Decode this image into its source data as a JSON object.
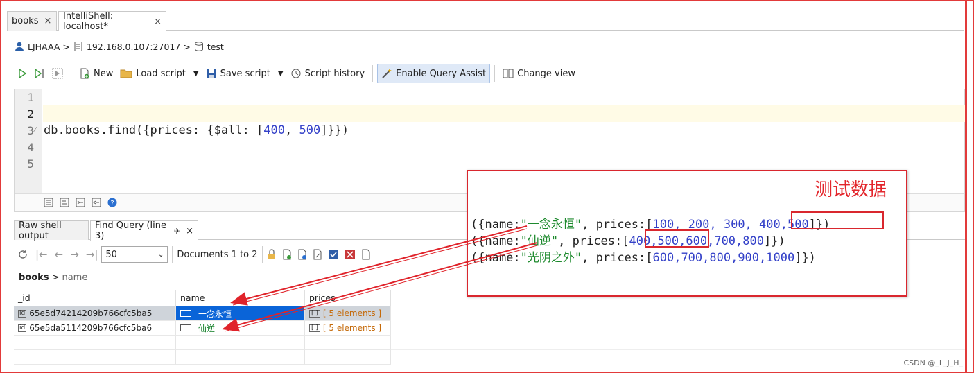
{
  "tabs": [
    {
      "label": "books",
      "close": "×"
    },
    {
      "label": "IntelliShell: localhost*",
      "close": "×"
    }
  ],
  "breadcrumb": {
    "user": "LJHAAA",
    "server": "192.168.0.107:27017",
    "database": "test"
  },
  "toolbar": {
    "new": "New",
    "load_script": "Load script",
    "save_script": "Save script",
    "script_history": "Script history",
    "query_assist": "Enable Query Assist",
    "change_view": "Change view"
  },
  "editor": {
    "line_numbers": [
      "1",
      "2",
      "3",
      "4",
      "5"
    ],
    "code_prefix": "db.books.find({prices: {$all: [",
    "n1": "400",
    ", ": ", ",
    "n2": "500",
    "code_suffix": "]}})"
  },
  "result_tabs": {
    "raw": "Raw shell output",
    "find": "Find Query (line 3)"
  },
  "nav": {
    "page_size": "50",
    "documents": "Documents 1 to 2"
  },
  "path": {
    "collection": "books",
    "field": "name"
  },
  "grid": {
    "columns": [
      "_id",
      "name",
      "prices"
    ],
    "rows": [
      {
        "id": "65e5d74214209b766cfc5ba5",
        "name": "一念永恒",
        "prices": "[ 5 elements ]"
      },
      {
        "id": "65e5da5114209b766cfc5ba6",
        "name": "仙逆",
        "prices": "[ 5 elements ]"
      }
    ]
  },
  "annotation": {
    "title": "测试数据",
    "lines": [
      {
        "open": "({name:",
        "str": "\"一念永恒\"",
        "mid": ", prices:[",
        "nums_a": "100, 200, 300, ",
        "nums_b": "400,500",
        "close": "]})"
      },
      {
        "open": "({name:",
        "str": "\"仙逆\"",
        "mid": ", prices:[",
        "nums_b": "400,500",
        "nums_a": ",600,700,800",
        "close": "]})"
      },
      {
        "open": "({name:",
        "str": "\"光阴之外\"",
        "mid": ", prices:[",
        "nums_a": "600,700,800,900,1000",
        "close": "]})"
      }
    ]
  },
  "watermark": "CSDN @_L_J_H_",
  "colors": {
    "annotation_red": "#d9272e",
    "selection_blue": "#0a64d8",
    "string_green": "#16812b",
    "number_blue": "#3340c8"
  }
}
